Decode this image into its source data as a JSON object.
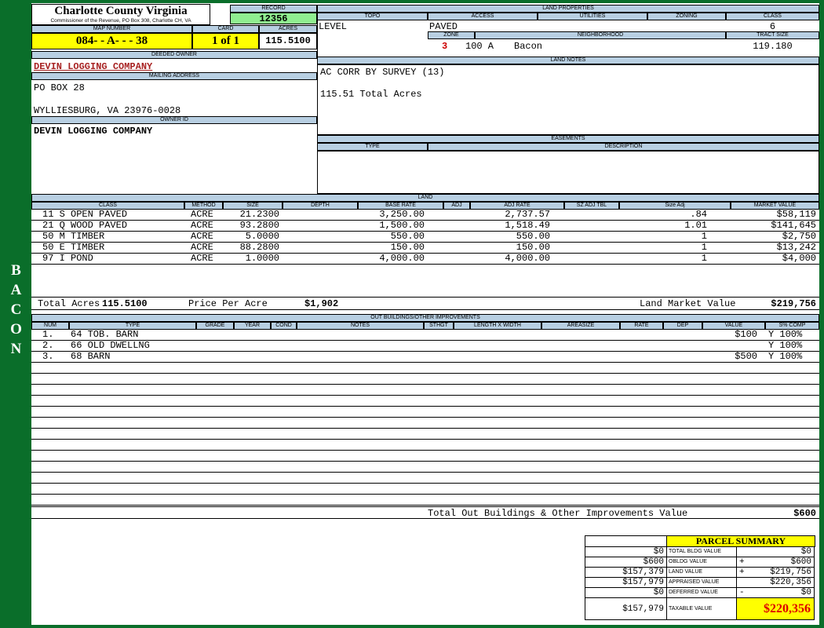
{
  "colors": {
    "page_green": "#0a6e2a",
    "header_blue": "#b8cfe2",
    "field_yellow": "#ffff00",
    "record_green": "#90ee90",
    "alert_red": "#cc0000",
    "owner_red": "#a82222"
  },
  "sidebar": {
    "district_label": "BACON"
  },
  "county": {
    "title": "Charlotte County Virginia",
    "subtitle": "Commissioner of the Revenue, PO Box 308, Charlotte CH, VA"
  },
  "record": {
    "label": "RECORD",
    "value": "12356"
  },
  "parcel": {
    "map_number_label": "MAP NUMBER",
    "map_number": "084- - A- - - 38",
    "card_label": "CARD",
    "card": "1 of 1",
    "acres_label": "ACRES",
    "acres": "115.5100"
  },
  "owner": {
    "deeded_owner_label": "DEEDED OWNER",
    "deeded_owner": "DEVIN LOGGING COMPANY",
    "mailing_address_label": "MAILING ADDRESS",
    "address_line1": "PO BOX 28",
    "address_line2": "WYLLIESBURG, VA 23976-0028",
    "owner_id_label": "OWNER ID",
    "owner_id": "DEVIN LOGGING COMPANY"
  },
  "land_properties": {
    "title": "LAND PROPERTIES",
    "topo_label": "TOPO",
    "topo": "LEVEL",
    "access_label": "ACCESS",
    "access": "PAVED",
    "utilities_label": "UTILITIES",
    "utilities": "",
    "zoning_label": "ZONING",
    "zoning": "",
    "class_label": "CLASS",
    "class": "6",
    "zone_label": "ZONE",
    "zone": "3",
    "zone_code": "100 A",
    "neighborhood_label": "NEIGHBORHOOD",
    "neighborhood": "Bacon",
    "tract_size_label": "TRACT SIZE",
    "tract_size": "119.180"
  },
  "land_notes": {
    "title": "LAND NOTES",
    "line1": "AC CORR BY SURVEY (13)",
    "line2": "115.51 Total Acres"
  },
  "easements": {
    "title": "EASEMENTS",
    "type_label": "TYPE",
    "description_label": "DESCRIPTION"
  },
  "land": {
    "title": "LAND",
    "headers": [
      "CLASS",
      "METHOD",
      "SIZE",
      "DEPTH",
      "BASE RATE",
      "ADJ",
      "ADJ RATE",
      "SZ ADJ TBL",
      "Size Adj",
      "MARKET VALUE"
    ],
    "rows": [
      {
        "class": "11 S OPEN PAVED",
        "method": "ACRE",
        "size": "21.2300",
        "base_rate": "3,250.00",
        "adj_rate": "2,737.57",
        "size_adj": ".84",
        "market_value": "$58,119"
      },
      {
        "class": "21 Q WOOD PAVED",
        "method": "ACRE",
        "size": "93.2800",
        "base_rate": "1,500.00",
        "adj_rate": "1,518.49",
        "size_adj": "1.01",
        "market_value": "$141,645"
      },
      {
        "class": "50 M TIMBER",
        "method": "ACRE",
        "size": "5.0000",
        "base_rate": "550.00",
        "adj_rate": "550.00",
        "size_adj": "1",
        "market_value": "$2,750"
      },
      {
        "class": "50 E TIMBER",
        "method": "ACRE",
        "size": "88.2800",
        "base_rate": "150.00",
        "adj_rate": "150.00",
        "size_adj": "1",
        "market_value": "$13,242"
      },
      {
        "class": "97 I POND",
        "method": "ACRE",
        "size": "1.0000",
        "base_rate": "4,000.00",
        "adj_rate": "4,000.00",
        "size_adj": "1",
        "market_value": "$4,000"
      }
    ],
    "total_acres_label": "Total Acres",
    "total_acres": "115.5100",
    "price_per_acre_label": "Price Per Acre",
    "price_per_acre": "$1,902",
    "market_value_label": "Land Market Value",
    "market_value": "$219,756"
  },
  "out_buildings": {
    "title": "OUT BUILDINGS/OTHER IMPROVEMENTS",
    "headers": [
      "NUM",
      "TYPE",
      "GRADE",
      "YEAR",
      "COND",
      "NOTES",
      "STHGT",
      "LENGTH X WIDTH",
      "AREASIZE",
      "RATE",
      "DEP",
      "VALUE",
      "S% COMP"
    ],
    "rows": [
      {
        "num": "1.",
        "type": "64 TOB. BARN",
        "value": "$100",
        "comp": "Y 100%"
      },
      {
        "num": "2.",
        "type": "66 OLD DWELLNG",
        "value": "",
        "comp": "Y 100%"
      },
      {
        "num": "3.",
        "type": "68 BARN",
        "value": "$500",
        "comp": "Y 100%"
      }
    ],
    "total_label": "Total Out Buildings & Other Improvements Value",
    "total_value": "$600"
  },
  "summary": {
    "title": "PARCEL SUMMARY",
    "rows": [
      {
        "prior": "$0",
        "label": "TOTAL BLDG VALUE",
        "op": "",
        "value": "$0"
      },
      {
        "prior": "$600",
        "label": "OBLDG VALUE",
        "op": "+",
        "value": "$600"
      },
      {
        "prior": "$157,379",
        "label": "LAND VALUE",
        "op": "+",
        "value": "$219,756"
      },
      {
        "prior": "$157,979",
        "label": "APPRAISED VALUE",
        "op": "",
        "value": "$220,356"
      },
      {
        "prior": "$0",
        "label": "DEFERRED VALUE",
        "op": "-",
        "value": "$0"
      },
      {
        "prior": "$157,979",
        "label": "TAXABLE VALUE",
        "op": "",
        "value": "$220,356"
      }
    ]
  }
}
